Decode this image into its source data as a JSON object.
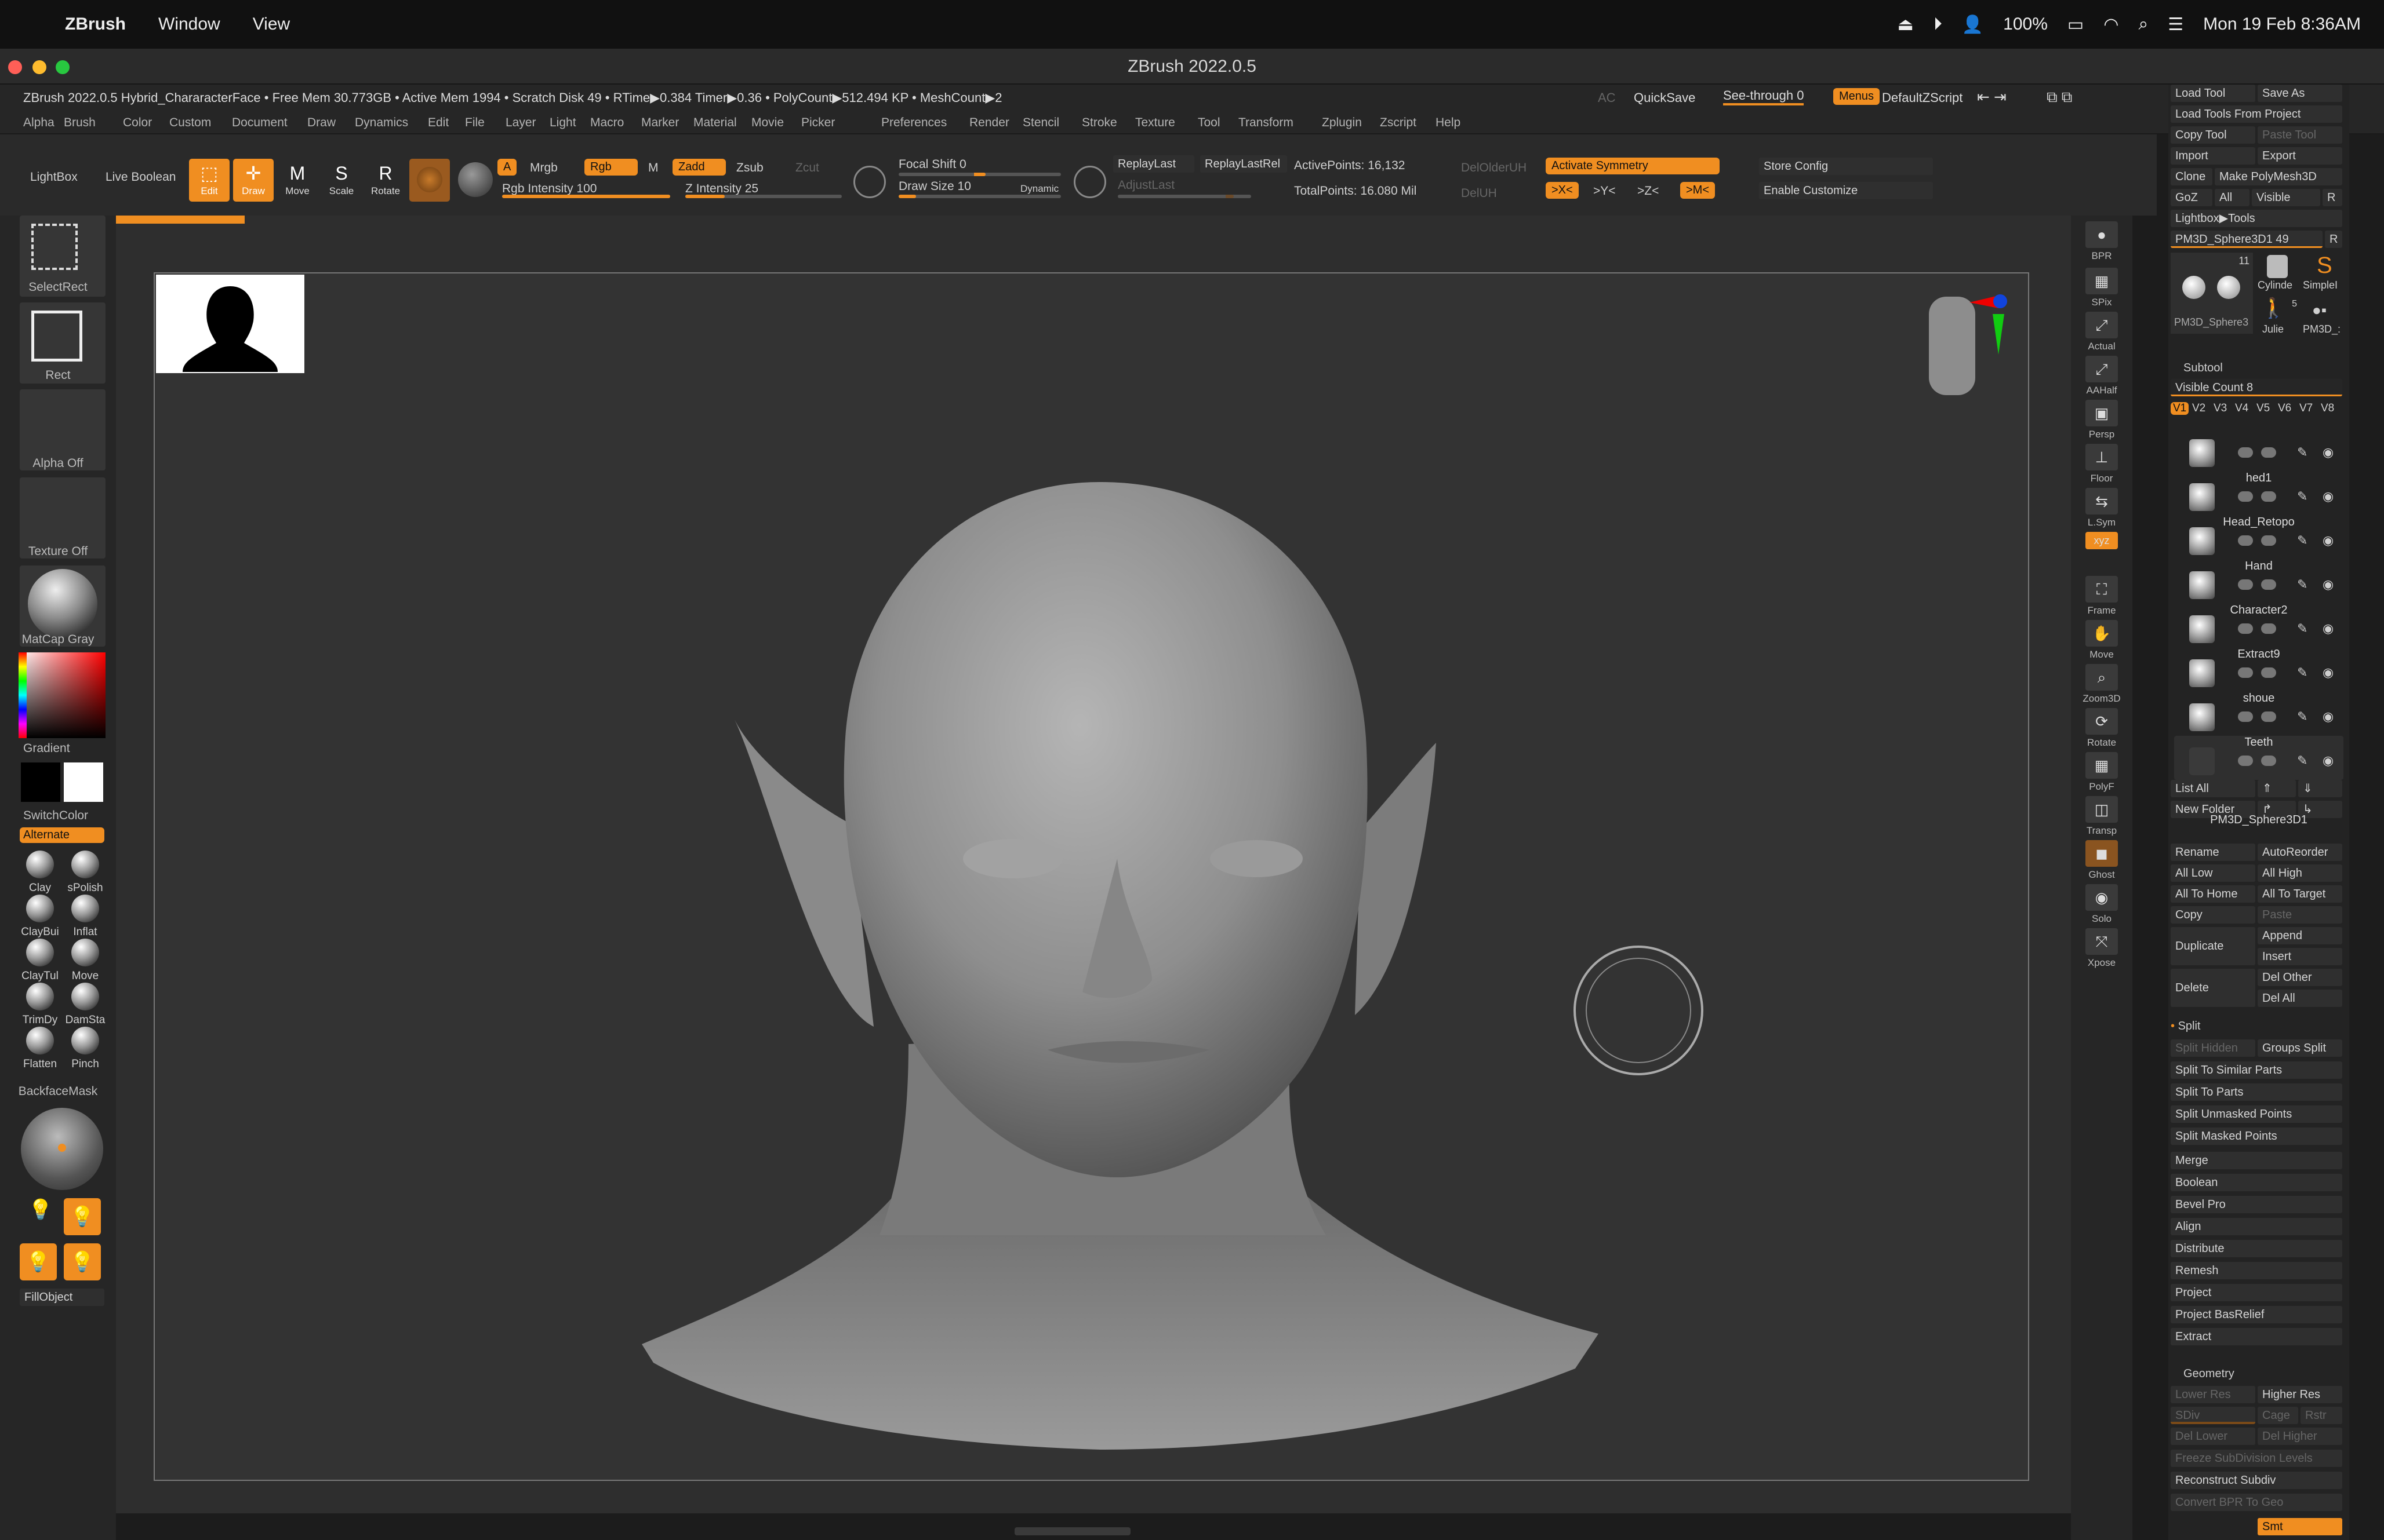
{
  "macos": {
    "app": "ZBrush",
    "menus": [
      "Window",
      "View"
    ],
    "battery": "100%",
    "clock": "Mon 19 Feb  8:36AM"
  },
  "window": {
    "title": "ZBrush 2022.0.5"
  },
  "infobar": {
    "status": "ZBrush 2022.0.5 Hybrid_ChararacterFace   • Free Mem 30.773GB • Active Mem 1994 • Scratch Disk 49 •  RTime▶0.384 Timer▶0.36 • PolyCount▶512.494 KP • MeshCount▶2",
    "ac": "AC",
    "quicksave": "QuickSave",
    "see_through": "See-through  0",
    "menus": "Menus",
    "script": "DefaultZScript"
  },
  "menubar": [
    "Alpha",
    "Brush",
    "Color",
    "Custom",
    "Document",
    "Draw",
    "Dynamics",
    "Edit",
    "File",
    "Layer",
    "Light",
    "Macro",
    "Marker",
    "Material",
    "Movie",
    "Picker",
    "Preferences",
    "Render",
    "Stencil",
    "Stroke",
    "Texture",
    "Tool",
    "Transform",
    "Zplugin",
    "Zscript",
    "Help"
  ],
  "toolbar": {
    "lightbox": "LightBox",
    "live_boolean": "Live Boolean",
    "edit": "Edit",
    "draw": "Draw",
    "move": "Move",
    "scale": "Scale",
    "rotate": "Rotate",
    "a": "A",
    "mrgb": "Mrgb",
    "rgb": "Rgb",
    "m": "M",
    "rgb_intensity": "Rgb Intensity 100",
    "rgb_intensity_value": 100,
    "zadd": "Zadd",
    "zsub": "Zsub",
    "zcut": "Zcut",
    "z_intensity": "Z Intensity 25",
    "z_intensity_value": 25,
    "focal_shift": "Focal Shift 0",
    "draw_size": "Draw Size 10",
    "dynamic": "Dynamic",
    "replay_last": "ReplayLast",
    "replay_last_rel": "ReplayLastRel",
    "adjust_last": "AdjustLast",
    "active_points": "ActivePoints: 16,132",
    "total_points": "TotalPoints: 16.080 Mil",
    "del_lower": "DelOlderUH",
    "del_uh": "DelUH",
    "activate_symmetry": "Activate Symmetry",
    "sym_x": ">X<",
    "sym_y": ">Y<",
    "sym_z": ">Z<",
    "sym_m": ">M<",
    "store_config": "Store Config",
    "enable_customize": "Enable Customize"
  },
  "left_shelf": {
    "selectrect": "SelectRect",
    "rect": "Rect",
    "alpha_off": "Alpha Off",
    "texture_off": "Texture Off",
    "matcap": "MatCap Gray",
    "gradient": "Gradient",
    "switchcolor": "SwitchColor",
    "alternate": "Alternate",
    "brushes": [
      "Clay",
      "sPolish",
      "ClayBui",
      "Inflat",
      "ClayTul",
      "Move",
      "TrimDy",
      "DamSta",
      "Flatten",
      "Pinch"
    ],
    "backfacemask": "BackfaceMask",
    "fillobject": "FillObject"
  },
  "right_bar": [
    "BPR",
    "SPix",
    "Actual",
    "AAHalf",
    "Persp",
    "Floor",
    "L.Sym",
    "",
    "Frame",
    "Move",
    "Zoom3D",
    "Rotate",
    "PolyF",
    "Transp",
    "Ghost",
    "Solo",
    "Xpose"
  ],
  "tool_panel": {
    "load_tool": "Load Tool",
    "save_as": "Save As",
    "load_from_project": "Load Tools From Project",
    "copy_tool": "Copy Tool",
    "paste_tool": "Paste Tool",
    "import": "Import",
    "export": "Export",
    "clone": "Clone",
    "make_polymesh": "Make PolyMesh3D",
    "goz": "GoZ",
    "all": "All",
    "visible": "Visible",
    "r": "R",
    "lightbox_tools": "Lightbox▶Tools",
    "current_tool": "PM3D_Sphere3D1  49",
    "thumb_count": "11",
    "thumb_labels": [
      "PM3D_Sphere3",
      "Cylinde",
      "SimpleI",
      "Julie",
      "PM3D_:"
    ],
    "julie_count": "5",
    "subtool_header": "Subtool",
    "visible_count": "Visible Count 8",
    "versions": [
      "V1",
      "V2",
      "V3",
      "V4",
      "V5",
      "V6",
      "V7",
      "V8"
    ],
    "subtools": [
      "",
      "hed1",
      "Head_Retopo",
      "Hand",
      "Character2",
      "Extract9",
      "shoue",
      "Teeth",
      "PM3D_Sphere3D1"
    ],
    "list_all": "List All",
    "new_folder": "New Folder",
    "rename": "Rename",
    "autoreorder": "AutoReorder",
    "all_low": "All Low",
    "all_high": "All High",
    "all_to_home": "All To Home",
    "all_to_target": "All To Target",
    "copy": "Copy",
    "paste": "Paste",
    "duplicate": "Duplicate",
    "append": "Append",
    "insert": "Insert",
    "delete": "Delete",
    "del_other": "Del Other",
    "del_all": "Del All",
    "split": "Split",
    "split_hidden": "Split Hidden",
    "groups_split": "Groups Split",
    "split_similar": "Split To Similar Parts",
    "split_parts": "Split To Parts",
    "split_unmasked": "Split Unmasked Points",
    "split_masked": "Split Masked Points",
    "merge": "Merge",
    "boolean": "Boolean",
    "bevel_pro": "Bevel Pro",
    "align": "Align",
    "distribute": "Distribute",
    "remesh": "Remesh",
    "project": "Project",
    "project_basrelief": "Project BasRelief",
    "extract": "Extract",
    "geometry": "Geometry",
    "lower_res": "Lower Res",
    "higher_res": "Higher Res",
    "sdiv": "SDiv",
    "cage": "Cage",
    "rstr": "Rstr",
    "del_lower": "Del Lower",
    "del_higher": "Del Higher",
    "freeze": "Freeze SubDivision Levels",
    "reconstruct": "Reconstruct Subdiv",
    "convert_bpr": "Convert BPR To Geo",
    "smt": "Smt"
  },
  "colors": {
    "accent": "#f08e21",
    "bg": "#2e2e2e",
    "panel": "#262626"
  }
}
